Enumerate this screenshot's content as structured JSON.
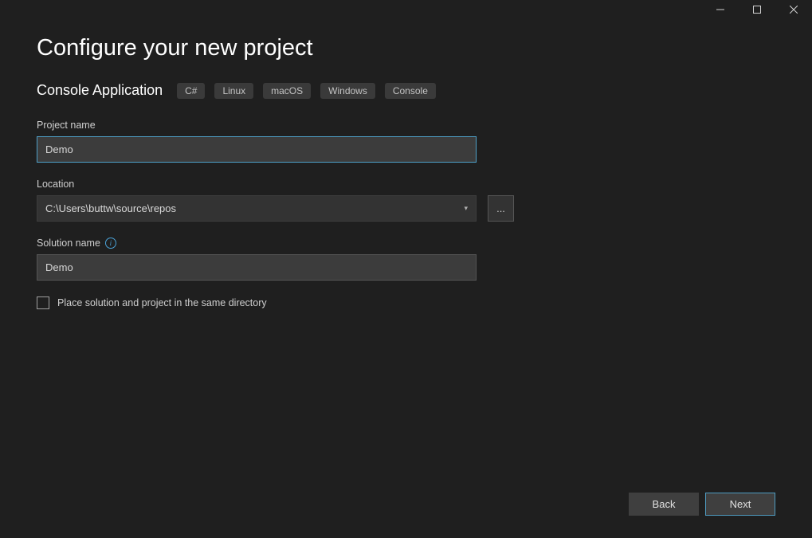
{
  "window": {
    "title": "Configure your new project"
  },
  "template": {
    "name": "Console Application",
    "tags": [
      "C#",
      "Linux",
      "macOS",
      "Windows",
      "Console"
    ]
  },
  "fields": {
    "project_name": {
      "label": "Project name",
      "value": "Demo"
    },
    "location": {
      "label": "Location",
      "value": "C:\\Users\\buttw\\source\\repos",
      "browse_label": "..."
    },
    "solution_name": {
      "label": "Solution name",
      "value": "Demo"
    },
    "same_directory": {
      "label": "Place solution and project in the same directory",
      "checked": false
    }
  },
  "footer": {
    "back": "Back",
    "next": "Next"
  }
}
